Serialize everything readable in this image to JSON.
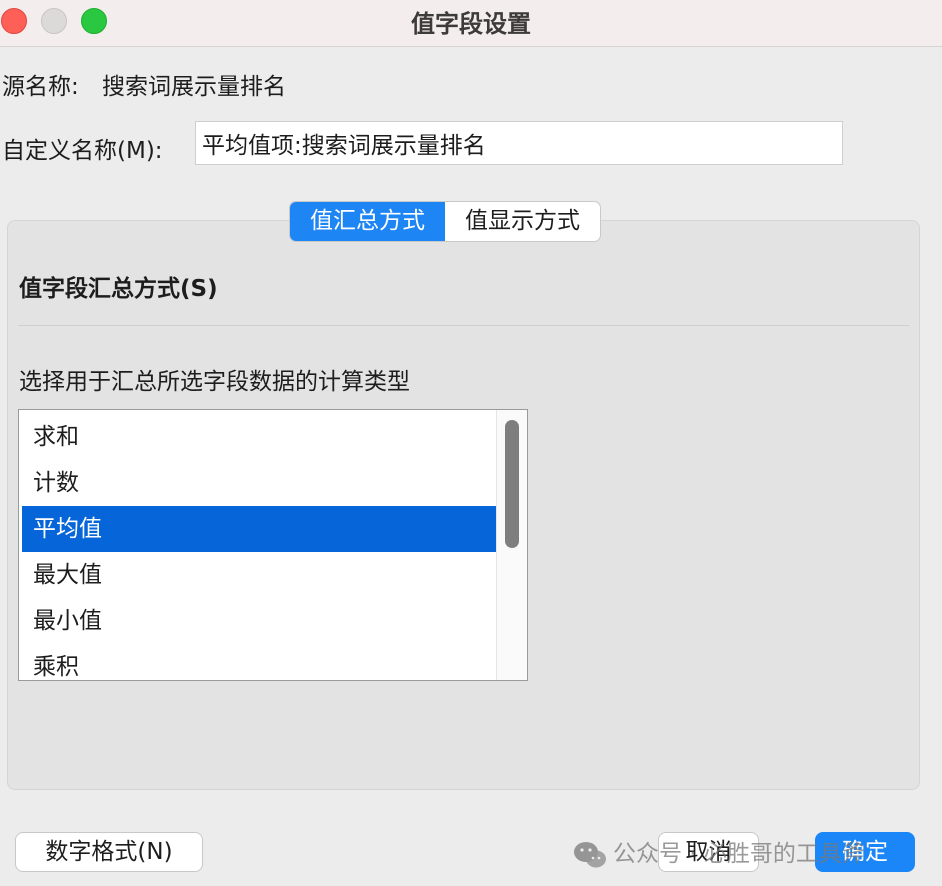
{
  "window": {
    "title": "值字段设置"
  },
  "source": {
    "label": "源名称:",
    "value": "搜索词展示量排名"
  },
  "custom_name": {
    "label": "自定义名称(M):",
    "value": "平均值项:搜索词展示量排名"
  },
  "tabs": [
    {
      "label": "值汇总方式",
      "active": true
    },
    {
      "label": "值显示方式",
      "active": false
    }
  ],
  "summary": {
    "title": "值字段汇总方式(S)",
    "hint": "选择用于汇总所选字段数据的计算类型",
    "items": [
      "求和",
      "计数",
      "平均值",
      "最大值",
      "最小值",
      "乘积"
    ],
    "selected": "平均值"
  },
  "buttons": {
    "number_format": "数字格式(N)",
    "cancel": "取消",
    "ok": "确定"
  },
  "watermark": {
    "text": "公众号 · 必胜哥的工具斧",
    "icon": "wechat-icon"
  },
  "colors": {
    "accent": "#1e85f5",
    "selection": "#0665d8"
  }
}
